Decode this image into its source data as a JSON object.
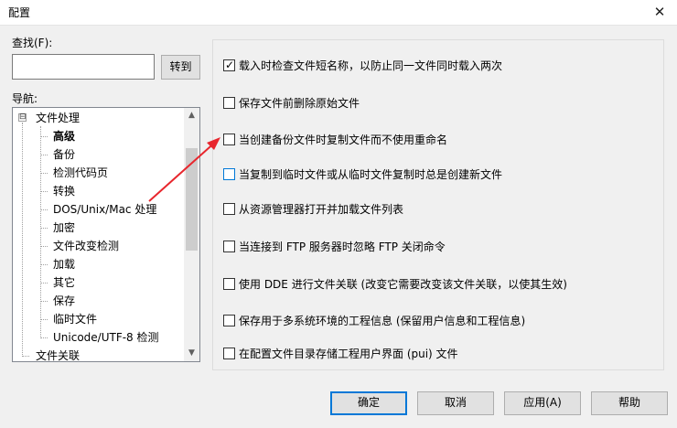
{
  "window": {
    "title": "配置",
    "close_symbol": "✕"
  },
  "search": {
    "label": "查找(F):",
    "value": "",
    "go_button": "转到"
  },
  "nav": {
    "label": "导航:",
    "expander_symbol": "⊟",
    "items": [
      {
        "label": "文件处理",
        "level": 0,
        "bold": false
      },
      {
        "label": "高级",
        "level": 1,
        "bold": true
      },
      {
        "label": "备份",
        "level": 1,
        "bold": false
      },
      {
        "label": "检测代码页",
        "level": 1,
        "bold": false
      },
      {
        "label": "转换",
        "level": 1,
        "bold": false
      },
      {
        "label": "DOS/Unix/Mac 处理",
        "level": 1,
        "bold": false
      },
      {
        "label": "加密",
        "level": 1,
        "bold": false
      },
      {
        "label": "文件改变检测",
        "level": 1,
        "bold": false
      },
      {
        "label": "加载",
        "level": 1,
        "bold": false
      },
      {
        "label": "其它",
        "level": 1,
        "bold": false
      },
      {
        "label": "保存",
        "level": 1,
        "bold": false
      },
      {
        "label": "临时文件",
        "level": 1,
        "bold": false
      },
      {
        "label": "Unicode/UTF-8 检测",
        "level": 1,
        "bold": false
      },
      {
        "label": "文件关联",
        "level": 0,
        "bold": false
      }
    ],
    "scroll_up": "▲",
    "scroll_down": "▼"
  },
  "options": [
    {
      "label": "载入时检查文件短名称，以防止同一文件同时载入两次",
      "checked": true
    },
    {
      "label": "保存文件前删除原始文件",
      "checked": false
    },
    {
      "label": "当创建备份文件时复制文件而不使用重命名",
      "checked": false
    },
    {
      "label": "当复制到临时文件或从临时文件复制时总是创建新文件",
      "checked": false,
      "focused": true
    },
    {
      "label": "从资源管理器打开并加载文件列表",
      "checked": false
    },
    {
      "label": "当连接到 FTP 服务器时忽略 FTP 关闭命令",
      "checked": false
    },
    {
      "label": "使用 DDE 进行文件关联 (改变它需要改变该文件关联，以使其生效)",
      "checked": false
    },
    {
      "label": "保存用于多系统环境的工程信息 (保留用户信息和工程信息)",
      "checked": false
    },
    {
      "label": "在配置文件目录存储工程用户界面 (pui) 文件",
      "checked": false
    }
  ],
  "check_symbol": "✓",
  "buttons": {
    "ok": "确定",
    "cancel": "取消",
    "apply": "应用(A)",
    "help": "帮助"
  },
  "colors": {
    "annotation_arrow": "#e8262d",
    "accent": "#0078d7"
  }
}
